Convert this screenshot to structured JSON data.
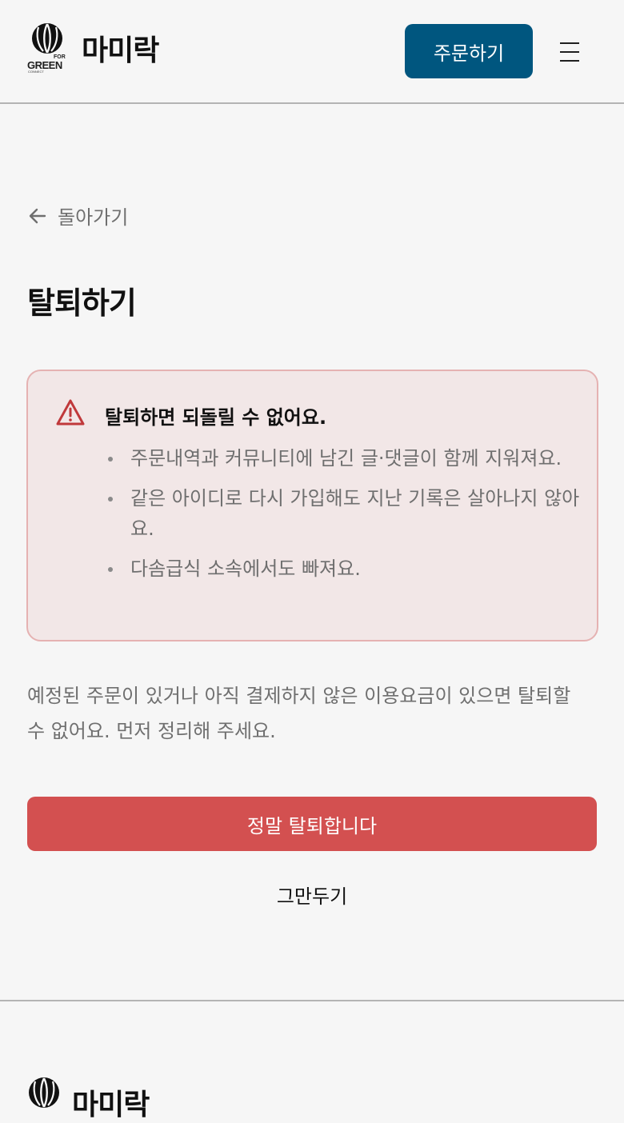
{
  "header": {
    "logo": {
      "brand_name": "마미락",
      "mark_text_for": "FOR",
      "mark_text_green": "GREEN",
      "mark_text_connect": "CONNECT"
    },
    "order_button_label": "주문하기",
    "menu_icon": "hamburger-icon"
  },
  "main": {
    "back_label": "돌아가기",
    "back_icon": "arrow-left-icon",
    "title": "탈퇴하기",
    "warning": {
      "icon": "warning-triangle-icon",
      "title": "탈퇴하면 되돌릴 수 없어요.",
      "items": [
        "주문내역과 커뮤니티에 남긴 글·댓글이 함께 지워져요.",
        "같은 아이디로 다시 가입해도 지난 기록은 살아나지 않아요.",
        "다솜급식 소속에서도 빠져요."
      ]
    },
    "notice": "예정된 주문이 있거나 아직 결제하지 않은 이용요금이 있으면 탈퇴할 수 없어요. 먼저 정리해 주세요.",
    "confirm_button_label": "정말 탈퇴합니다",
    "cancel_button_label": "그만두기"
  },
  "footer": {
    "brand_name": "마미락"
  },
  "colors": {
    "primary": "#00567f",
    "danger": "#d35050",
    "warning_bg": "#f2e7e7",
    "warning_border": "#e5b2b2",
    "warning_icon": "#c0393b",
    "background": "#f6f6f6"
  }
}
